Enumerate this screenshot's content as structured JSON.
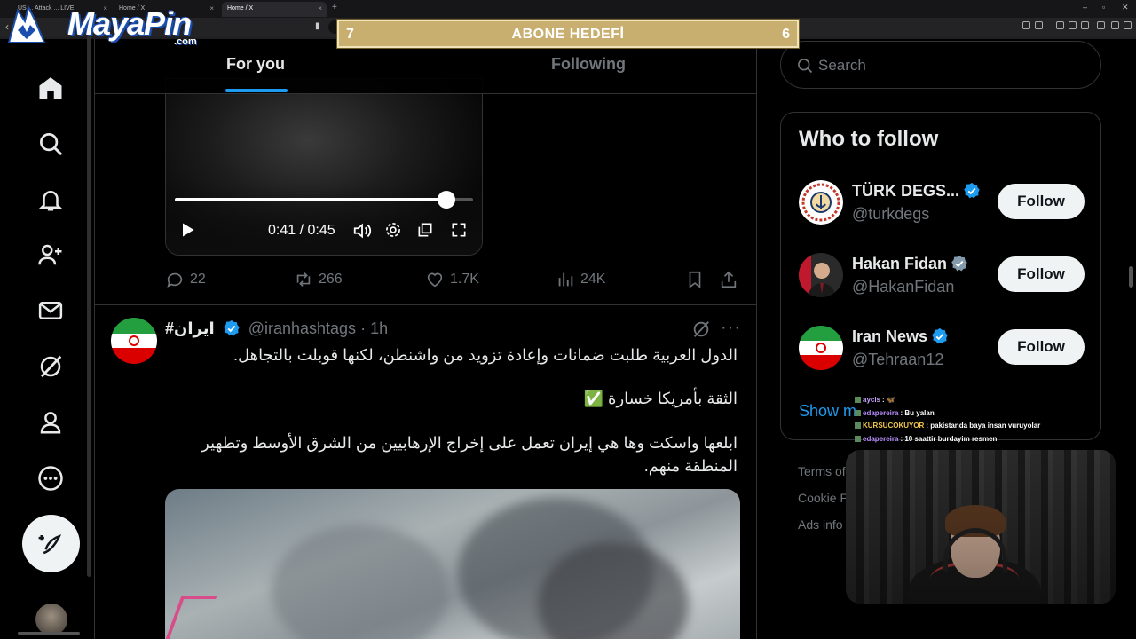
{
  "browser": {
    "tabs": [
      {
        "label": "US ... Attack ... LIVE",
        "active": false
      },
      {
        "label": "Home / X",
        "active": false
      },
      {
        "label": "Home / X",
        "active": true
      }
    ]
  },
  "overlay": {
    "logo_text": "MayaPin",
    "logo_sub": ".com",
    "goal_left": "7",
    "goal_title": "ABONE HEDEFİ",
    "goal_right": "6"
  },
  "nav": {
    "items": [
      "home-icon",
      "explore-icon",
      "notifications-icon",
      "communities-icon",
      "messages-icon",
      "grok-icon",
      "profile-icon",
      "more-icon"
    ],
    "compose_icon": "compose-icon"
  },
  "feed": {
    "tab_for_you": "For you",
    "tab_following": "Following",
    "video": {
      "time": "0:41 / 0:45",
      "progress_percent": 91
    },
    "tweet1_stats": {
      "replies": "22",
      "reposts": "266",
      "likes": "1.7K",
      "views": "24K"
    },
    "tweet2": {
      "name": "#ایران",
      "handle": "@iranhashtags",
      "time": "· 1h",
      "line1": "الدول العربية طلبت ضمانات وإعادة تزويد من واشنطن، لكنها قوبلت بالتجاهل.",
      "line2": "الثقة بأمريكا خسارة ✅",
      "line3": "ابلعها واسكت وها هي إيران تعمل على إخراج الإرهابيين من الشرق الأوسط وتطهير المنطقة منهم."
    }
  },
  "sidebar": {
    "search_placeholder": "Search",
    "who_to_follow_title": "Who to follow",
    "accounts": [
      {
        "name": "TÜRK DEGS...",
        "handle": "@turkdegs",
        "badge": "blue",
        "button": "Follow"
      },
      {
        "name": "Hakan Fidan",
        "handle": "@HakanFidan",
        "badge": "gray",
        "button": "Follow"
      },
      {
        "name": "Iran News",
        "handle": "@Tehraan12",
        "badge": "blue",
        "button": "Follow"
      }
    ],
    "show_more": "Show m",
    "footer": [
      "Terms of",
      "Cookie P",
      "Ads info"
    ]
  },
  "chat": [
    {
      "user": "aycis",
      "color": "#c9a6ff",
      "msg": ": 🦋"
    },
    {
      "user": "edapereira",
      "color": "#b98cff",
      "msg": ": Bu yalan"
    },
    {
      "user": "KURSUCOKUYOR",
      "color": "#f2c94c",
      "msg": ": pakistanda baya insan vuruyolar"
    },
    {
      "user": "edapereira",
      "color": "#b98cff",
      "msg": ": 10 saattir burdayim resmen"
    }
  ],
  "colors": {
    "accent": "#1d9bf0",
    "verified_blue": "#1d9bf0",
    "verified_gray": "#829aab",
    "goal_bg": "#c8ae6f"
  }
}
